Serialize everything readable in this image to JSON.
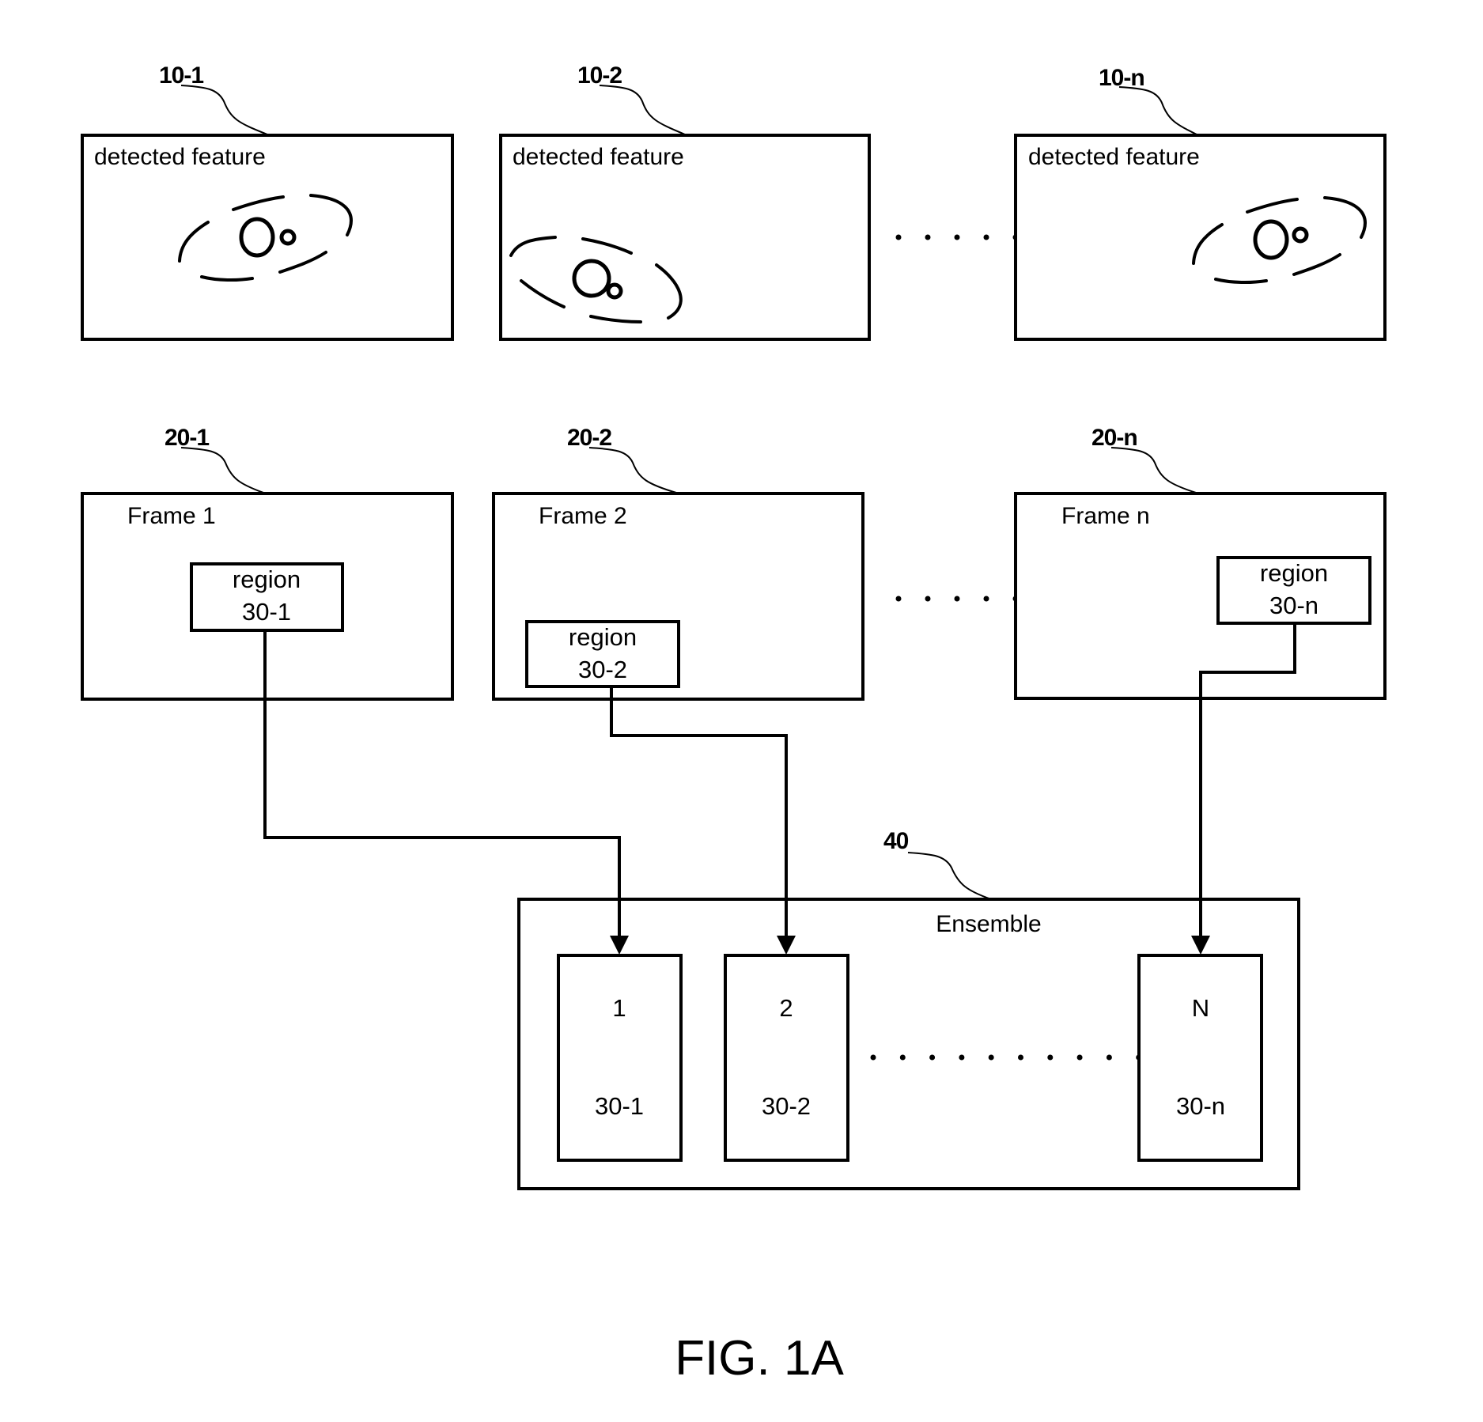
{
  "figure": {
    "caption": "FIG. 1A"
  },
  "detected_row": {
    "boxes": [
      {
        "ref": "10-1",
        "title": "detected feature"
      },
      {
        "ref": "10-2",
        "title": "detected feature"
      },
      {
        "ref": "10-n",
        "title": "detected feature"
      }
    ],
    "ellipsis_dot_count": 5
  },
  "frame_row": {
    "frames": [
      {
        "ref": "20-1",
        "title": "Frame 1",
        "region_label": "region",
        "region_id": "30-1"
      },
      {
        "ref": "20-2",
        "title": "Frame 2",
        "region_label": "region",
        "region_id": "30-2"
      },
      {
        "ref": "20-n",
        "title": "Frame n",
        "region_label": "region",
        "region_id": "30-n"
      }
    ],
    "ellipsis_dot_count": 5
  },
  "ensemble": {
    "ref": "40",
    "title": "Ensemble",
    "members": [
      {
        "index": "1",
        "region_id": "30-1"
      },
      {
        "index": "2",
        "region_id": "30-2"
      },
      {
        "index": "N",
        "region_id": "30-n"
      }
    ],
    "ellipsis_dot_count": 10
  }
}
